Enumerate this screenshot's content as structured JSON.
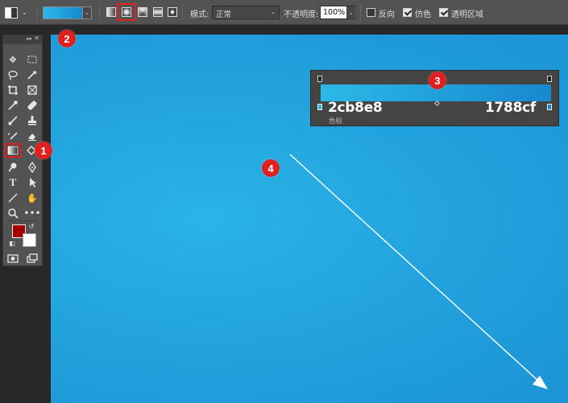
{
  "options_bar": {
    "tool_preset_icon": "gradient-tool-preset-icon",
    "chevron": "⌄",
    "gradient_preview": {
      "start_color": "#2cb8e8",
      "end_color": "#1788cf"
    },
    "gradient_types": [
      "linear",
      "radial",
      "angle",
      "reflected",
      "diamond"
    ],
    "selected_type": "radial",
    "mode_label": "模式:",
    "mode_value": "正常",
    "opacity_label": "不透明度:",
    "opacity_value": "100%",
    "reverse_label": "反向",
    "reverse_checked": false,
    "dither_label": "仿色",
    "dither_checked": true,
    "transparency_label": "透明区域",
    "transparency_checked": true
  },
  "toolbox": {
    "foreground_color": "#a50000",
    "background_color": "#ffffff",
    "selected_tool": "gradient-tool"
  },
  "gradient_editor": {
    "start_hex": "2cb8e8",
    "end_hex": "1788cf",
    "stop_label": "色标"
  },
  "markers": [
    "1",
    "2",
    "3",
    "4"
  ],
  "colors": {
    "accent_red": "#e01f1f",
    "canvas_blue": "#23a4de"
  }
}
